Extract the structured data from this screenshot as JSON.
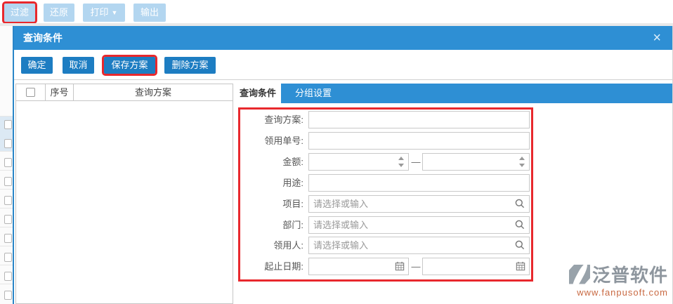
{
  "toolbar": {
    "filter": "过滤",
    "restore": "还原",
    "print": "打印",
    "print_caret": "▼",
    "export": "输出"
  },
  "dialog": {
    "title": "查询条件",
    "close": "×",
    "confirm": "确定",
    "cancel": "取消",
    "save_plan": "保存方案",
    "delete_plan": "删除方案",
    "table": {
      "col_seq": "序号",
      "col_plan": "查询方案"
    },
    "tabs": {
      "query": "查询条件",
      "group": "分组设置"
    },
    "form": {
      "rows": [
        {
          "label": "查询方案:",
          "type": "text",
          "value": ""
        },
        {
          "label": "领用单号:",
          "type": "text",
          "value": ""
        },
        {
          "label": "金额:",
          "type": "number-range",
          "separator": "—",
          "min": "",
          "max": ""
        },
        {
          "label": "用途:",
          "type": "text",
          "value": ""
        },
        {
          "label": "项目:",
          "type": "lookup",
          "placeholder": "请选择或输入",
          "value": ""
        },
        {
          "label": "部门:",
          "type": "lookup",
          "placeholder": "请选择或输入",
          "value": ""
        },
        {
          "label": "领用人:",
          "type": "lookup",
          "placeholder": "请选择或输入",
          "value": ""
        },
        {
          "label": "起止日期:",
          "type": "date-range",
          "separator": "—",
          "start": "",
          "end": ""
        }
      ]
    }
  },
  "watermark": {
    "brand": "泛普软件",
    "url": "www.fanpusoft.com"
  },
  "colors": {
    "header_blue": "#2e8fd4",
    "button_blue": "#1d7dc2",
    "toolbar_blue": "#b3d6f0",
    "highlight_red": "#e8282d"
  }
}
